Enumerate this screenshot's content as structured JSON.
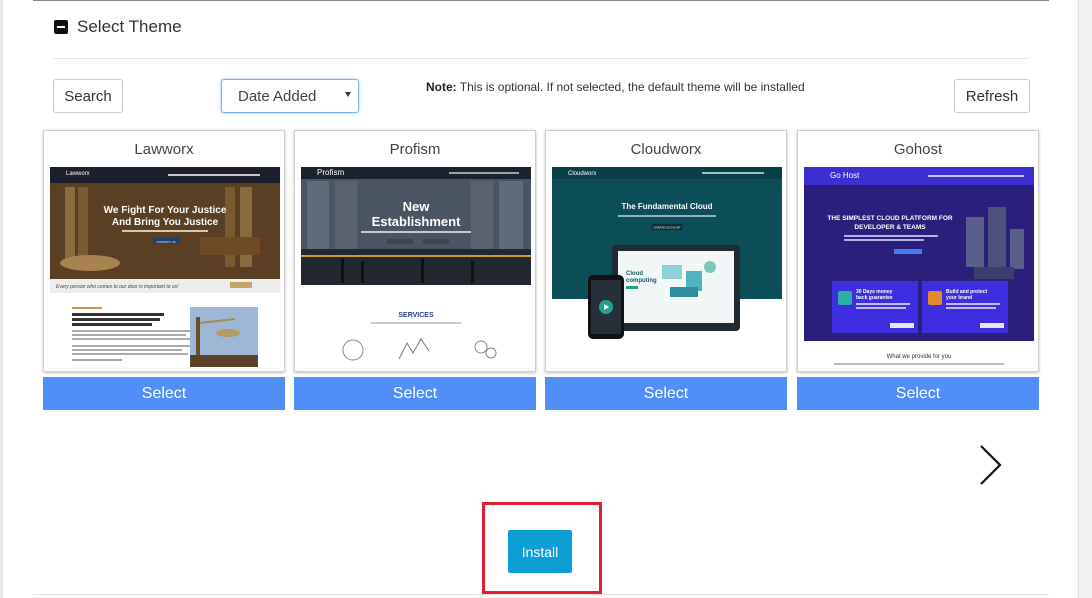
{
  "section": {
    "title": "Select Theme"
  },
  "toolbar": {
    "search_label": "Search",
    "sort_value": "Date Added",
    "note_label": "Note:",
    "note_text": " This is optional. If not selected, the default theme will be installed",
    "refresh_label": "Refresh"
  },
  "themes": [
    {
      "name": "Lawworx",
      "select_label": "Select",
      "preview": {
        "brand": "Lawworx",
        "hero_line1": "We Fight For Your Justice",
        "hero_line2": "And Bring You Justice",
        "cta": "CONTACT US",
        "banner": "Every person who comes to our door is important to us!"
      }
    },
    {
      "name": "Profism",
      "select_label": "Select",
      "preview": {
        "brand": "Profism",
        "hero_line1": "New",
        "hero_line2": "Establishment",
        "section_title": "SERVICES"
      }
    },
    {
      "name": "Cloudworx",
      "select_label": "Select",
      "preview": {
        "brand": "Cloudworx",
        "hero": "The Fundamental Cloud",
        "cta": "CREATE ACCOUNT",
        "device_text_1": "Cloud",
        "device_text_2": "computing"
      }
    },
    {
      "name": "Gohost",
      "select_label": "Select",
      "preview": {
        "brand": "Go Host",
        "hero_line1": "THE SIMPLEST CLOUD PLATFORM FOR",
        "hero_line2": "DEVELOPER & TEAMS",
        "box1_line1": "30 Days money",
        "box1_line2": "back guarantee",
        "box2_line1": "Build and protect",
        "box2_line2": "your brand",
        "footer": "What we provide for you"
      }
    }
  ],
  "pagination": {
    "next_icon": "chevron-right-icon"
  },
  "actions": {
    "install_label": "Install"
  },
  "colors": {
    "select_button": "#4f8ff7",
    "install_button": "#0e9ed6",
    "highlight_border": "#e0202c"
  }
}
